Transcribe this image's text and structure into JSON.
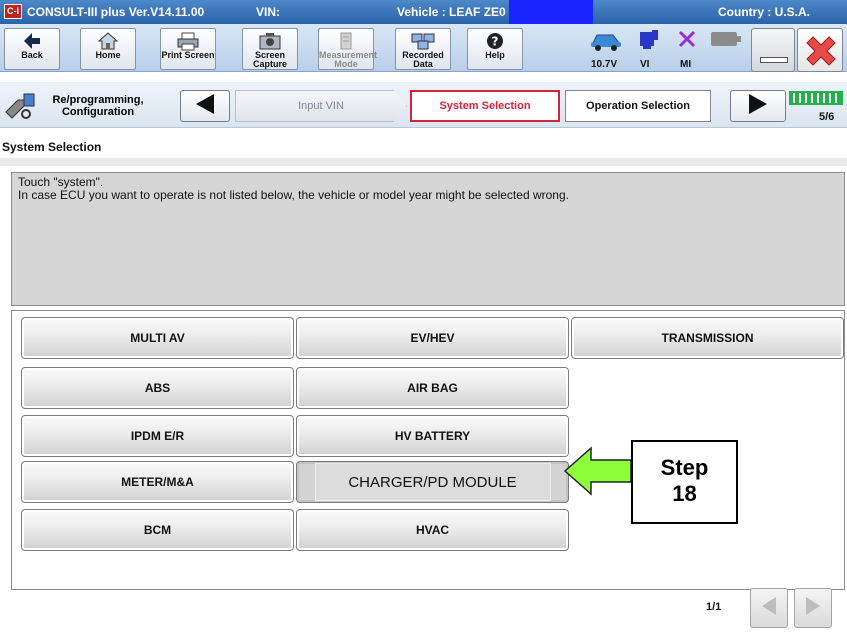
{
  "titlebar": {
    "logo": "C-I",
    "app": "CONSULT-III plus  Ver.V14.11.00",
    "vin_label": "VIN:",
    "vehicle": "Vehicle : LEAF ZE0",
    "country": "Country : U.S.A."
  },
  "toolbar": {
    "back": "Back",
    "home": "Home",
    "print": "Print Screen",
    "capture": "Screen Capture",
    "measurement": "Measurement Mode",
    "recorded": "Recorded Data",
    "help": "Help",
    "voltage": "10.7V",
    "vi": "VI",
    "mi": "MI"
  },
  "breadcrumb": {
    "reprog": "Re/programming, Configuration",
    "input_vin": "Input VIN",
    "system_selection": "System Selection",
    "operation_selection": "Operation Selection",
    "step_counter": "5/6"
  },
  "section": {
    "title": "System Selection"
  },
  "message": {
    "line1": "Touch \"system\".",
    "line2": "In case ECU you want to operate is not listed below, the vehicle or model year might be selected wrong."
  },
  "systems": [
    "MULTI AV",
    "EV/HEV",
    "TRANSMISSION",
    "ABS",
    "AIR BAG",
    "IPDM E/R",
    "HV BATTERY",
    "METER/M&A",
    "CHARGER/PD MODULE",
    "BCM",
    "HVAC"
  ],
  "callout": {
    "line1": "Step",
    "line2": "18"
  },
  "pager": {
    "indicator": "1/1"
  },
  "colors": {
    "titlebar": "#2a62a8",
    "vin_highlight": "#1a24ff",
    "active_tab": "#d3233a",
    "callout_arrow": "#8dff3a",
    "battery": "#22b14c"
  }
}
